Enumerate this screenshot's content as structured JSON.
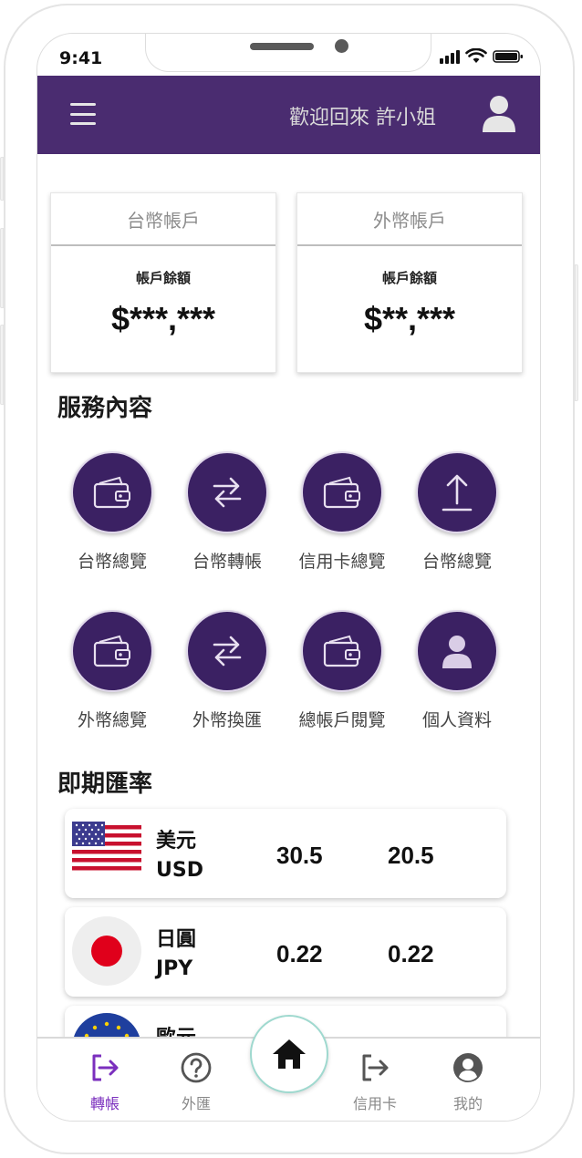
{
  "status_bar": {
    "time": "9:41"
  },
  "header": {
    "welcome": "歡迎回來 許小姐"
  },
  "accounts": [
    {
      "title": "台幣帳戶",
      "label": "帳戶餘額",
      "amount": "$***,***"
    },
    {
      "title": "外幣帳戶",
      "label": "帳戶餘額",
      "amount": "$**,***"
    }
  ],
  "services": {
    "title": "服務內容",
    "items": [
      {
        "label": "台幣總覽",
        "icon": "wallet-icon"
      },
      {
        "label": "台幣轉帳",
        "icon": "transfer-icon"
      },
      {
        "label": "信用卡總覽",
        "icon": "wallet-icon"
      },
      {
        "label": "台幣總覽",
        "icon": "upload-icon"
      },
      {
        "label": "外幣總覽",
        "icon": "wallet-icon"
      },
      {
        "label": "外幣換匯",
        "icon": "transfer-icon"
      },
      {
        "label": "總帳戶閱覽",
        "icon": "wallet-icon"
      },
      {
        "label": "個人資料",
        "icon": "person-icon"
      }
    ]
  },
  "rates": {
    "title": "即期匯率",
    "rows": [
      {
        "name": "美元",
        "code": "USD",
        "buy": "30.5",
        "sell": "20.5",
        "flag": "us-flag"
      },
      {
        "name": "日圓",
        "code": "JPY",
        "buy": "0.22",
        "sell": "0.22",
        "flag": "jp-flag"
      },
      {
        "name": "歐元",
        "code": "",
        "buy": "",
        "sell": "",
        "flag": "eu-flag"
      }
    ]
  },
  "bottom_nav": {
    "items": [
      {
        "label": "轉帳",
        "icon": "transfer-out-icon",
        "active": true
      },
      {
        "label": "外匯",
        "icon": "question-circle-icon",
        "active": false
      },
      {
        "label": "信用卡",
        "icon": "credit-card-exit-icon",
        "active": false
      },
      {
        "label": "我的",
        "icon": "account-circle-icon",
        "active": false
      }
    ],
    "home_icon": "home-icon"
  },
  "colors": {
    "header_bg": "#4a2c70",
    "service_circle": "#3b2163",
    "active_nav": "#7b2fbe"
  }
}
